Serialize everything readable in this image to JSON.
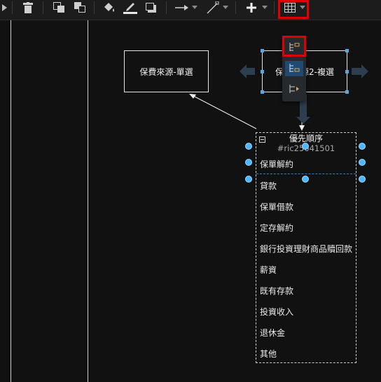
{
  "toolbar": {
    "buttons": [
      {
        "name": "forward-icon"
      },
      {
        "name": "trash-icon"
      },
      {
        "name": "to-front-icon"
      },
      {
        "name": "to-back-icon"
      },
      {
        "name": "fill-color-icon"
      },
      {
        "name": "line-color-icon"
      },
      {
        "name": "shadow-icon"
      },
      {
        "name": "connection-arrow-icon"
      },
      {
        "name": "waypoint-icon"
      },
      {
        "name": "plus-icon"
      },
      {
        "name": "table-icon"
      }
    ],
    "highlight_color": "#e00000"
  },
  "table_menu": {
    "items": [
      {
        "name": "insert-row-above-icon"
      },
      {
        "name": "insert-row-below-icon"
      },
      {
        "name": "insert-column-icon"
      }
    ],
    "selected_index": 1
  },
  "canvas": {
    "shape_left": {
      "label": "保費來源-單選"
    },
    "shape_right": {
      "label": "保費來源2-複選"
    },
    "list": {
      "title": "優先順序",
      "id": "#ric25641501",
      "items": [
        "保單解約",
        "貸款",
        "保單借款",
        "定存解約",
        "銀行投資理財商品贖回款",
        "薪資",
        "既有存款",
        "投資收入",
        "退休金",
        "其他"
      ]
    },
    "colors": {
      "background": "#111111",
      "accent": "#4db8ff",
      "selection": "#5aa7e0"
    }
  }
}
